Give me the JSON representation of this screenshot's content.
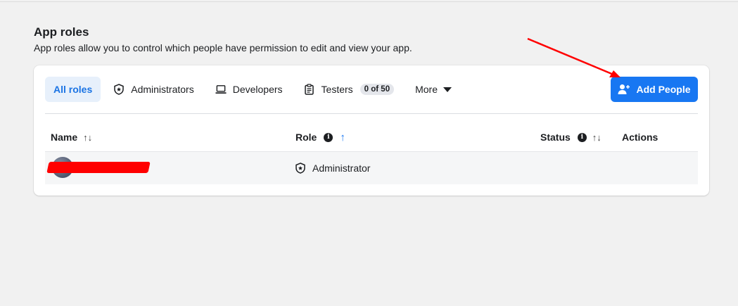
{
  "page": {
    "title": "App roles",
    "description": "App roles allow you to control which people have permission to edit and view your app."
  },
  "tabs": {
    "all_roles": "All roles",
    "administrators": "Administrators",
    "developers": "Developers",
    "testers": "Testers",
    "testers_count": "0 of 50",
    "more": "More"
  },
  "actions": {
    "add_people": "Add People"
  },
  "table": {
    "columns": {
      "name": "Name",
      "role": "Role",
      "status": "Status",
      "actions": "Actions"
    },
    "sort_glyph": "↑↓",
    "sort_asc_glyph": "↑",
    "info_glyph": "i",
    "rows": [
      {
        "role": "Administrator"
      }
    ]
  },
  "colors": {
    "accent": "#1877f2",
    "active_tab_bg": "#e7f0fb",
    "annotation": "#ff0000"
  },
  "icons": {
    "administrators": "shield-icon",
    "developers": "laptop-icon",
    "testers": "clipboard-icon",
    "more": "caret-down-icon",
    "add_people": "add-person-icon"
  }
}
